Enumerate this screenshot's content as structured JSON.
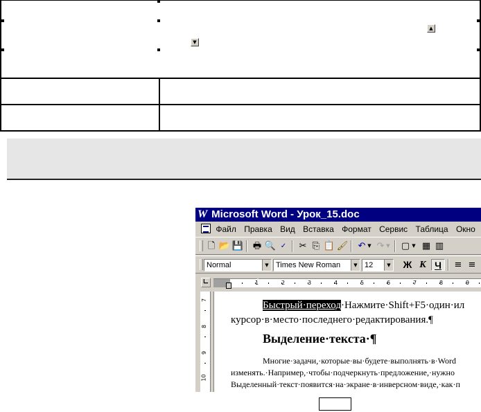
{
  "word": {
    "title": "Microsoft Word - Урок_15.doc",
    "menu": [
      "Файл",
      "Правка",
      "Вид",
      "Вставка",
      "Формат",
      "Сервис",
      "Таблица",
      "Окно",
      "?"
    ],
    "format_bar": {
      "style": "Normal",
      "font": "Times New Roman",
      "size": "12",
      "bold": "Ж",
      "italic": "К",
      "underline": "Ч"
    },
    "ruler_numbers": [
      "1",
      "2",
      "3",
      "4",
      "5",
      "6",
      "7",
      "8",
      "9"
    ],
    "vruler_numbers": [
      "7",
      "8",
      "9",
      "10"
    ],
    "document": {
      "p1_link": "Быстрый·переход",
      "p1_rest": "·Нажмите·Shift+F5·один·ил",
      "p1_line2": "курсор·в·место·последнего·редактирования.¶",
      "heading": "Выделение·текста·¶",
      "p2_line1": "Многие·задачи,·которые·вы·будете·выполнять·в·Word",
      "p2_line2": "изменять.·Например,·чтобы·подчеркнуть·предложение,·нужно",
      "p2_line3": "Выделенный·текст·появится·на·экране·в·инверсном·виде,·как·п"
    }
  }
}
